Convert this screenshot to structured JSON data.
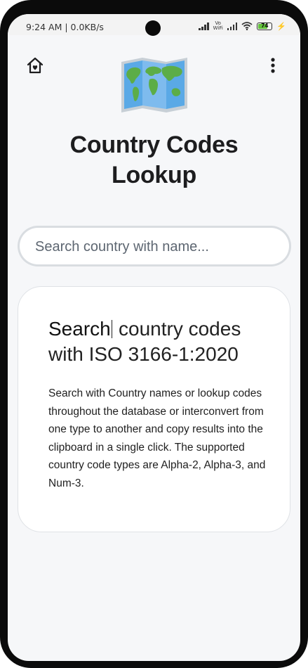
{
  "status_bar": {
    "time": "9:24 AM | 0.0KB/s",
    "vowifi_top": "Vo",
    "vowifi_bottom": "WiFi",
    "battery_level": "74",
    "battery_fraction": 0.74,
    "charging_icon": "bolt-icon",
    "battery_color": "#61c13a"
  },
  "header": {
    "home_icon": "home-heart-icon",
    "menu_icon": "more-vertical-icon",
    "logo_icon": "world-map-icon"
  },
  "title": {
    "line1": "Country Codes",
    "line2": "Lookup"
  },
  "search": {
    "value": "",
    "placeholder": "Search country with name..."
  },
  "info_card": {
    "heading_typed": "Search",
    "heading_rest": " country codes with ISO 3166-1:2020",
    "body": "Search with Country names or lookup codes throughout the database or interconvert from one type to another and copy results into the clipboard in a single click. The supported country code types are Alpha-2, Alpha-3, and Num-3."
  }
}
